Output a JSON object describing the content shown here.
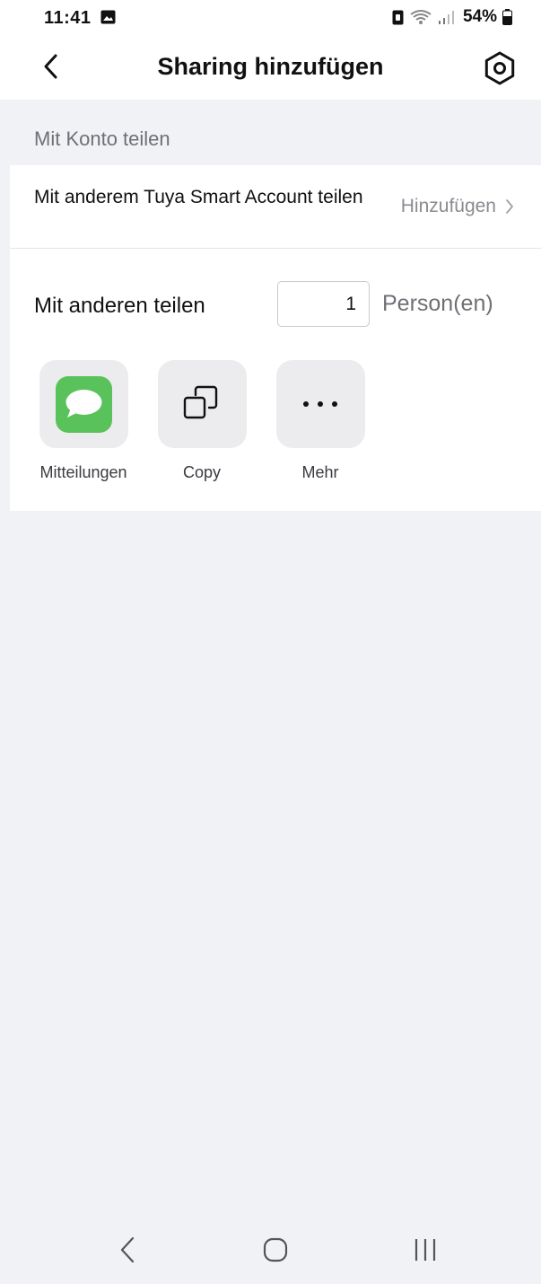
{
  "status_bar": {
    "time": "11:41",
    "battery": "54%"
  },
  "header": {
    "title": "Sharing hinzufügen"
  },
  "account_section": {
    "heading": "Mit Konto teilen",
    "row_label": "Mit anderem Tuya Smart Account teilen",
    "action_label": "Hinzufügen"
  },
  "share_section": {
    "label": "Mit anderen teilen",
    "count_value": "1",
    "count_unit": "Person(en)",
    "apps": [
      {
        "label": "Mitteilungen",
        "icon": "messages-icon"
      },
      {
        "label": "Copy",
        "icon": "copy-icon"
      },
      {
        "label": "Mehr",
        "icon": "more-icon"
      }
    ]
  },
  "colors": {
    "messages_green": "#5ac25a",
    "background": "#f1f2f6"
  }
}
